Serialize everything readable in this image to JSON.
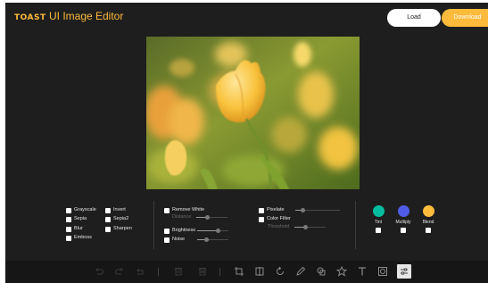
{
  "header": {
    "logo_brand": "TOAST",
    "logo_rest": "UI Image Editor",
    "load_label": "Load",
    "download_label": "Download"
  },
  "filters": {
    "col1": [
      "Grayscale",
      "Sepia",
      "Blur",
      "Emboss"
    ],
    "col2": [
      "Invert",
      "Sepia2",
      "Sharpen"
    ],
    "col3": {
      "remove_white": "Remove White",
      "distance": "Distance",
      "brightness": "Brightness",
      "noise": "Noise"
    },
    "col4": {
      "pixelate": "Pixelate",
      "color_filter": "Color Filter",
      "threshold": "Threshold"
    },
    "col5": [
      {
        "label": "Tint",
        "color": "#03bd9e"
      },
      {
        "label": "Multiply",
        "color": "#515ce6"
      },
      {
        "label": "Blend",
        "color": "#ffbb3b"
      }
    ]
  },
  "toolbar": {
    "icons": [
      "undo-icon",
      "redo-icon",
      "reset-icon",
      "delete-icon",
      "delete-all-icon",
      "crop-icon",
      "flip-icon",
      "rotate-icon",
      "draw-icon",
      "shape-icon",
      "icon-icon",
      "text-icon",
      "mask-icon",
      "filter-icon"
    ],
    "active": "filter-icon"
  },
  "colors": {
    "accent": "#fdba3b",
    "background": "#1e1e1e"
  }
}
